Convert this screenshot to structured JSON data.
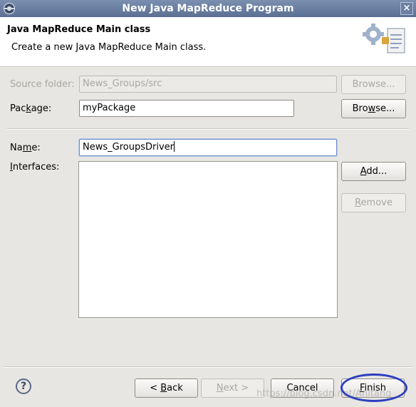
{
  "window": {
    "title": "New Java MapReduce Program",
    "close_glyph": "×"
  },
  "banner": {
    "heading": "Java MapReduce Main class",
    "description": "Create a new Java MapReduce Main class."
  },
  "form": {
    "source_folder": {
      "label": "Source folder:",
      "value": "News_Groups/src",
      "browse": "Browse..."
    },
    "package": {
      "label_pre": "Pac",
      "label_mn": "k",
      "label_post": "age:",
      "value": "myPackage",
      "browse_pre": "Bro",
      "browse_mn": "w",
      "browse_post": "se..."
    },
    "name": {
      "label_pre": "Na",
      "label_mn": "m",
      "label_post": "e:",
      "value": "News_GroupsDriver"
    },
    "interfaces": {
      "label_mn": "I",
      "label_post": "nterfaces:",
      "add_mn": "A",
      "add_post": "dd...",
      "remove_mn": "R",
      "remove_post": "emove"
    }
  },
  "footer": {
    "help": "?",
    "back_pre": "< ",
    "back_mn": "B",
    "back_post": "ack",
    "next_mn": "N",
    "next_post": "ext >",
    "cancel": "Cancel",
    "finish_mn": "F",
    "finish_post": "inish",
    "watermark": "https://blog.csdn.net/Anitang"
  }
}
